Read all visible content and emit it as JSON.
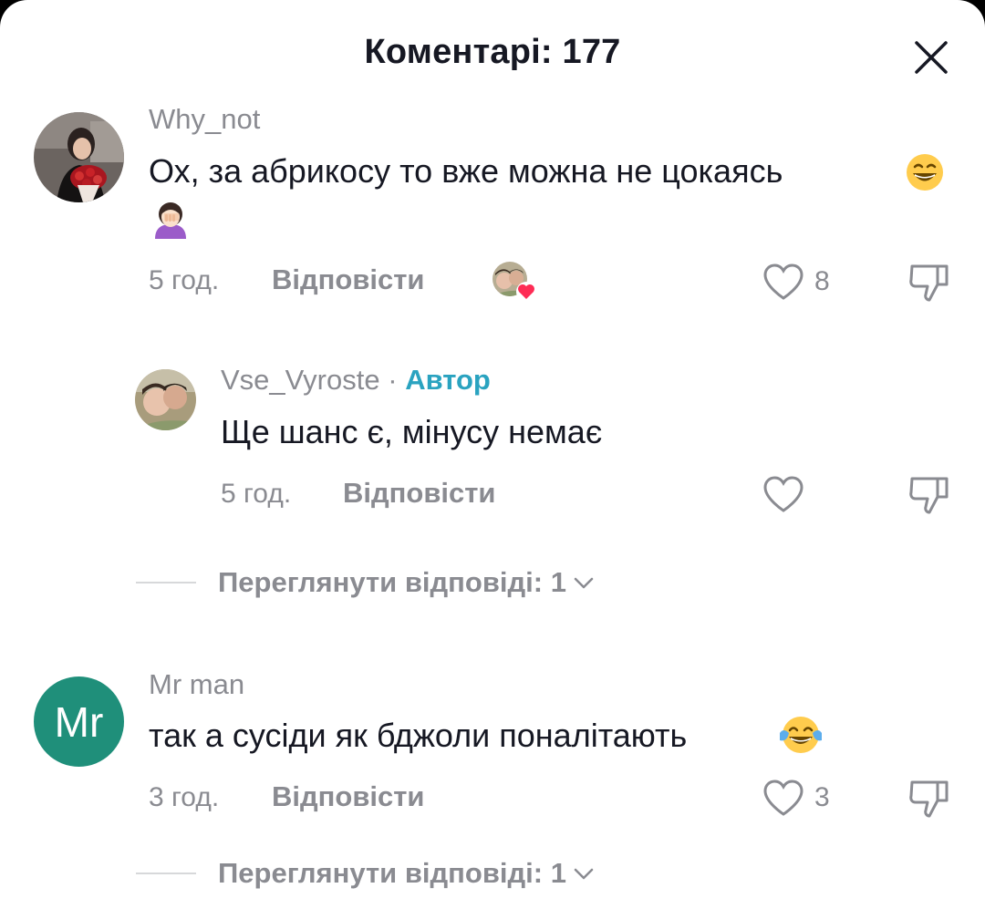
{
  "header": {
    "title": "Коментарі: 177"
  },
  "comments": [
    {
      "username": "Why_not",
      "text_line1": "Ох, за абрикосу то вже можна не цокаясь",
      "time": "5 год.",
      "reply_label": "Відповісти",
      "likes": "8",
      "creator_liked": true
    },
    {
      "username": "Vse_Vyroste",
      "author_separator": "·",
      "author_label": "Автор",
      "text_line1": "Ще шанс є, мінусу немає",
      "time": "5 год.",
      "reply_label": "Відповісти"
    },
    {
      "username": "Mr man",
      "avatar_initials": "Mr",
      "text_line1": "так а сусіди як бджоли поналітають",
      "time": "3 год.",
      "reply_label": "Відповісти",
      "likes": "3"
    }
  ],
  "view_replies": [
    {
      "label": "Переглянути відповіді: 1"
    },
    {
      "label": "Переглянути відповіді: 1"
    }
  ],
  "colors": {
    "author_accent": "#2aa3c0",
    "secondary_text": "#8a8b91",
    "avatar_mr_bg": "#1f8f7a"
  }
}
